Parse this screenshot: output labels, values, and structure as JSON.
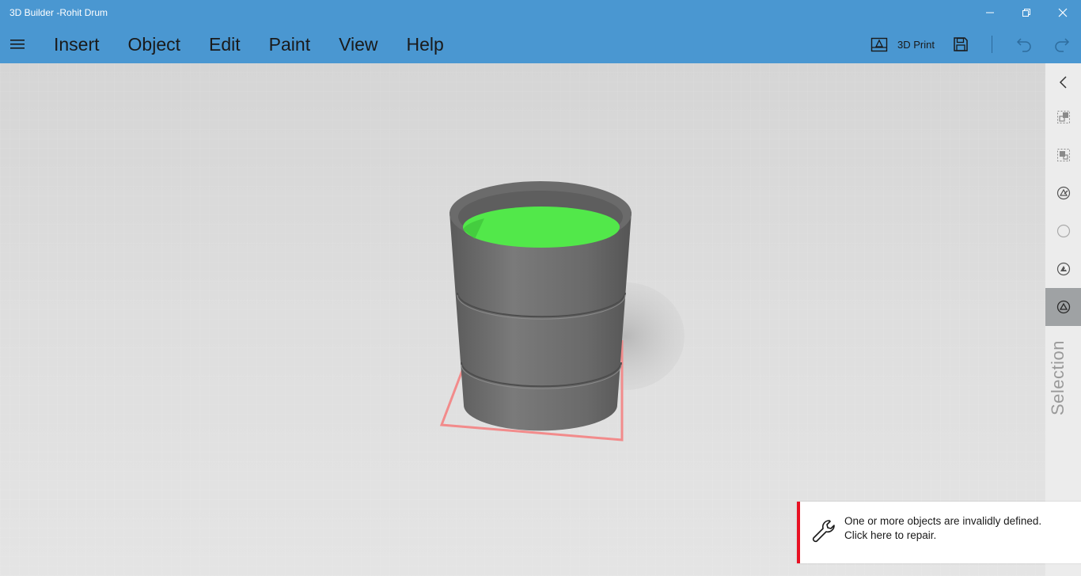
{
  "window": {
    "title": "3D Builder -Rohit Drum",
    "controls": [
      "minimize-icon",
      "restore-icon",
      "close-icon"
    ]
  },
  "menubar": {
    "items": [
      "Insert",
      "Object",
      "Edit",
      "Paint",
      "View",
      "Help"
    ]
  },
  "toolbar": {
    "print_label": "3D Print",
    "icons": [
      "3d-print-icon",
      "save-icon",
      "undo-icon",
      "redo-icon"
    ]
  },
  "scene": {
    "object": "drum",
    "body_color": "#6e6e6e",
    "fill_color": "#52e84a",
    "selection_box_color": "#f28b8b"
  },
  "right_rail": {
    "icons": [
      "chevron-left-icon",
      "duplicate-icon",
      "replace-icon",
      "edit-shape-icon",
      "circle-icon",
      "paint-shape-icon",
      "selection-icon"
    ],
    "label": "Selection"
  },
  "notification": {
    "line1": "One or more objects are invalidly defined.",
    "line2": "Click here to repair.",
    "accent": "#e81123"
  },
  "colors": {
    "titlebar": "#4a97d1",
    "viewport": "#d9d9d9",
    "rail": "#ececec"
  }
}
